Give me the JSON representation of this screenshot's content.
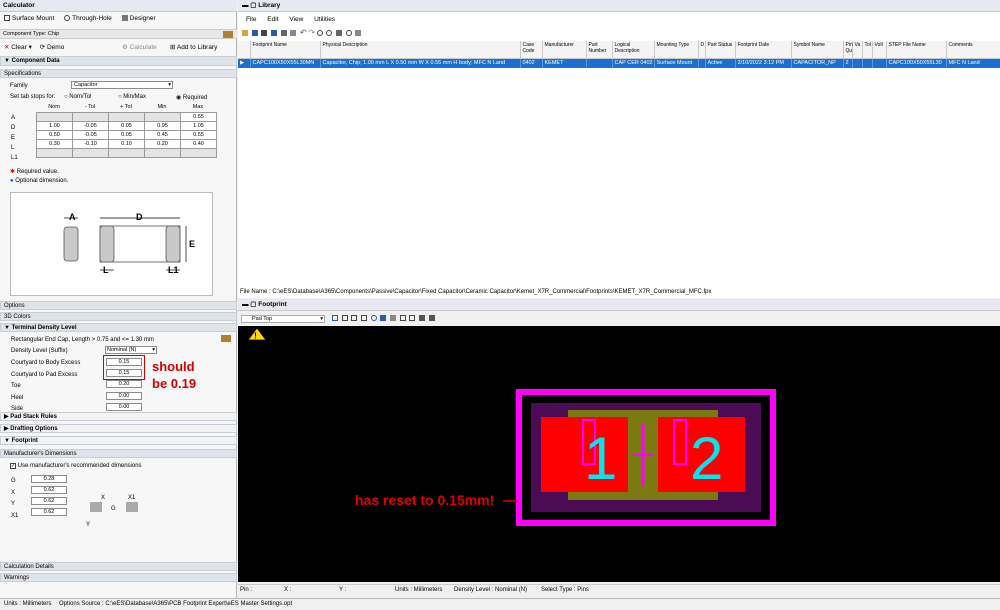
{
  "calculator": {
    "title": "Calculator",
    "modes": [
      "Surface Mount",
      "Through-Hole",
      "Designer"
    ],
    "component_type": "Component Type: Chip",
    "toolbar": {
      "clear": "Clear",
      "demo": "Demo",
      "calculate": "Calculate",
      "add_to_library": "Add to Library"
    },
    "component_data": "Component Data",
    "specifications": "Specifications",
    "family_label": "Family",
    "family_value": "Capacitor",
    "tab_stops_label": "Set tab stops for:",
    "tab_stops": [
      "Nom/Tol",
      "Min/Max",
      "Required"
    ],
    "cols": [
      "Nom",
      "- Tol",
      "+ Tol",
      "Min",
      "Max"
    ],
    "rows": [
      {
        "label": "A",
        "vals": [
          "",
          "",
          "",
          "",
          "0.55"
        ]
      },
      {
        "label": "D",
        "vals": [
          "1.00",
          "-0.05",
          "0.05",
          "0.95",
          "1.05"
        ]
      },
      {
        "label": "E",
        "vals": [
          "0.50",
          "-0.05",
          "0.05",
          "0.45",
          "0.55"
        ]
      },
      {
        "label": "L",
        "vals": [
          "0.30",
          "-0.10",
          "0.10",
          "0.20",
          "0.40"
        ]
      },
      {
        "label": "L1",
        "vals": [
          "",
          "",
          "",
          "",
          ""
        ]
      }
    ],
    "legend_required": "Required value.",
    "legend_optional": "Optional dimension.",
    "dims": {
      "a": "A",
      "d": "D",
      "e": "E",
      "l": "L",
      "l1": "L1"
    },
    "options": "Options",
    "colors_3d": "3D Colors",
    "terminal_density": "Terminal Density Level",
    "rect_end_cap": "Rectangular End Cap, Length > 0.75 and <= 1.30 mm",
    "density_label": "Density Level (Suffix)",
    "density_value": "Nominal (N)",
    "params": [
      {
        "label": "Courtyard to Body Excess",
        "value": "0.15"
      },
      {
        "label": "Courtyard to Pad Excess",
        "value": "0.15"
      },
      {
        "label": "Toe",
        "value": "0.20"
      },
      {
        "label": "Heel",
        "value": "0.00"
      },
      {
        "label": "Side",
        "value": "0.00"
      }
    ],
    "annotation_should": "should be 0.19",
    "pad_stack": "Pad Stack Rules",
    "drafting": "Drafting Options",
    "footprint": "Footprint",
    "mfr_dims": "Manufacturer's Dimensions",
    "use_mfr": "Use manufacturer's recommended dimensions",
    "mfr_vals": [
      {
        "label": "G",
        "value": "0.28"
      },
      {
        "label": "X",
        "value": "0.62"
      },
      {
        "label": "Y",
        "value": "0.62"
      },
      {
        "label": "X1",
        "value": "0.62"
      }
    ],
    "mfr_dim_labels": {
      "x": "X",
      "x1": "X1",
      "g": "G",
      "y": "Y"
    },
    "calc_details": "Calculation Details",
    "warnings": "Warnings"
  },
  "library": {
    "title": "Library",
    "menu": [
      "File",
      "Edit",
      "View",
      "Utilities"
    ],
    "columns": [
      "Footprint Name",
      "Physical Description",
      "Case Code",
      "Manufacturer",
      "Part Number",
      "Logical Description",
      "Mounting Type",
      "D",
      "Part Status",
      "Footprint Date",
      "Symbol Name",
      "Pin Qu",
      "Va",
      "Tol",
      "Volt",
      "STEP File Name",
      "Comments"
    ],
    "row": [
      "CAPC100X50X55L30MN",
      "Capacitor, Chip; 1.00 mm L X 0.50 mm W X 0.55 mm H body; MFC N Land",
      "0402",
      "KEMET",
      "",
      "CAP CER 0402",
      "Surface Mount",
      "",
      "Active",
      "2/10/2022 3:12 PM",
      "CAPACITOR_NP",
      "2",
      "",
      "",
      "",
      "CAPC100X50X55L30",
      "MFC N Land"
    ],
    "file_name": "File Name :   C:\\eES\\Database\\A365\\Components\\Passive\\Capacitor\\Fixed Capacitor\\Ceramic Capacitor\\Kemet_X7R_Commercial\\Footprints\\KEMET_X7R_Commercial_MFC.fpx"
  },
  "footprint": {
    "title": "Footprint",
    "layer": "Pad Top",
    "pads": [
      "1",
      "2"
    ],
    "annotation": "has reset to 0.15mm!",
    "status": {
      "pin": "Pin :",
      "x": "X :",
      "y": "Y :",
      "units": "Units : Millimeters",
      "density": "Density Level : Nominal (N)",
      "select": "Select Type : Pins"
    }
  },
  "statusbar": {
    "units": "Units :  Millimeters",
    "options": "Options Source :  C:\\eES\\Database\\A365\\PCB Footprint Expert\\eES Master Settings.opt"
  },
  "colors": {
    "selection": "#1a6fd1",
    "courtyard": "#ff00ff",
    "pad": "#ff0000",
    "silk": "#00e5ee",
    "annotation": "#d40000"
  }
}
